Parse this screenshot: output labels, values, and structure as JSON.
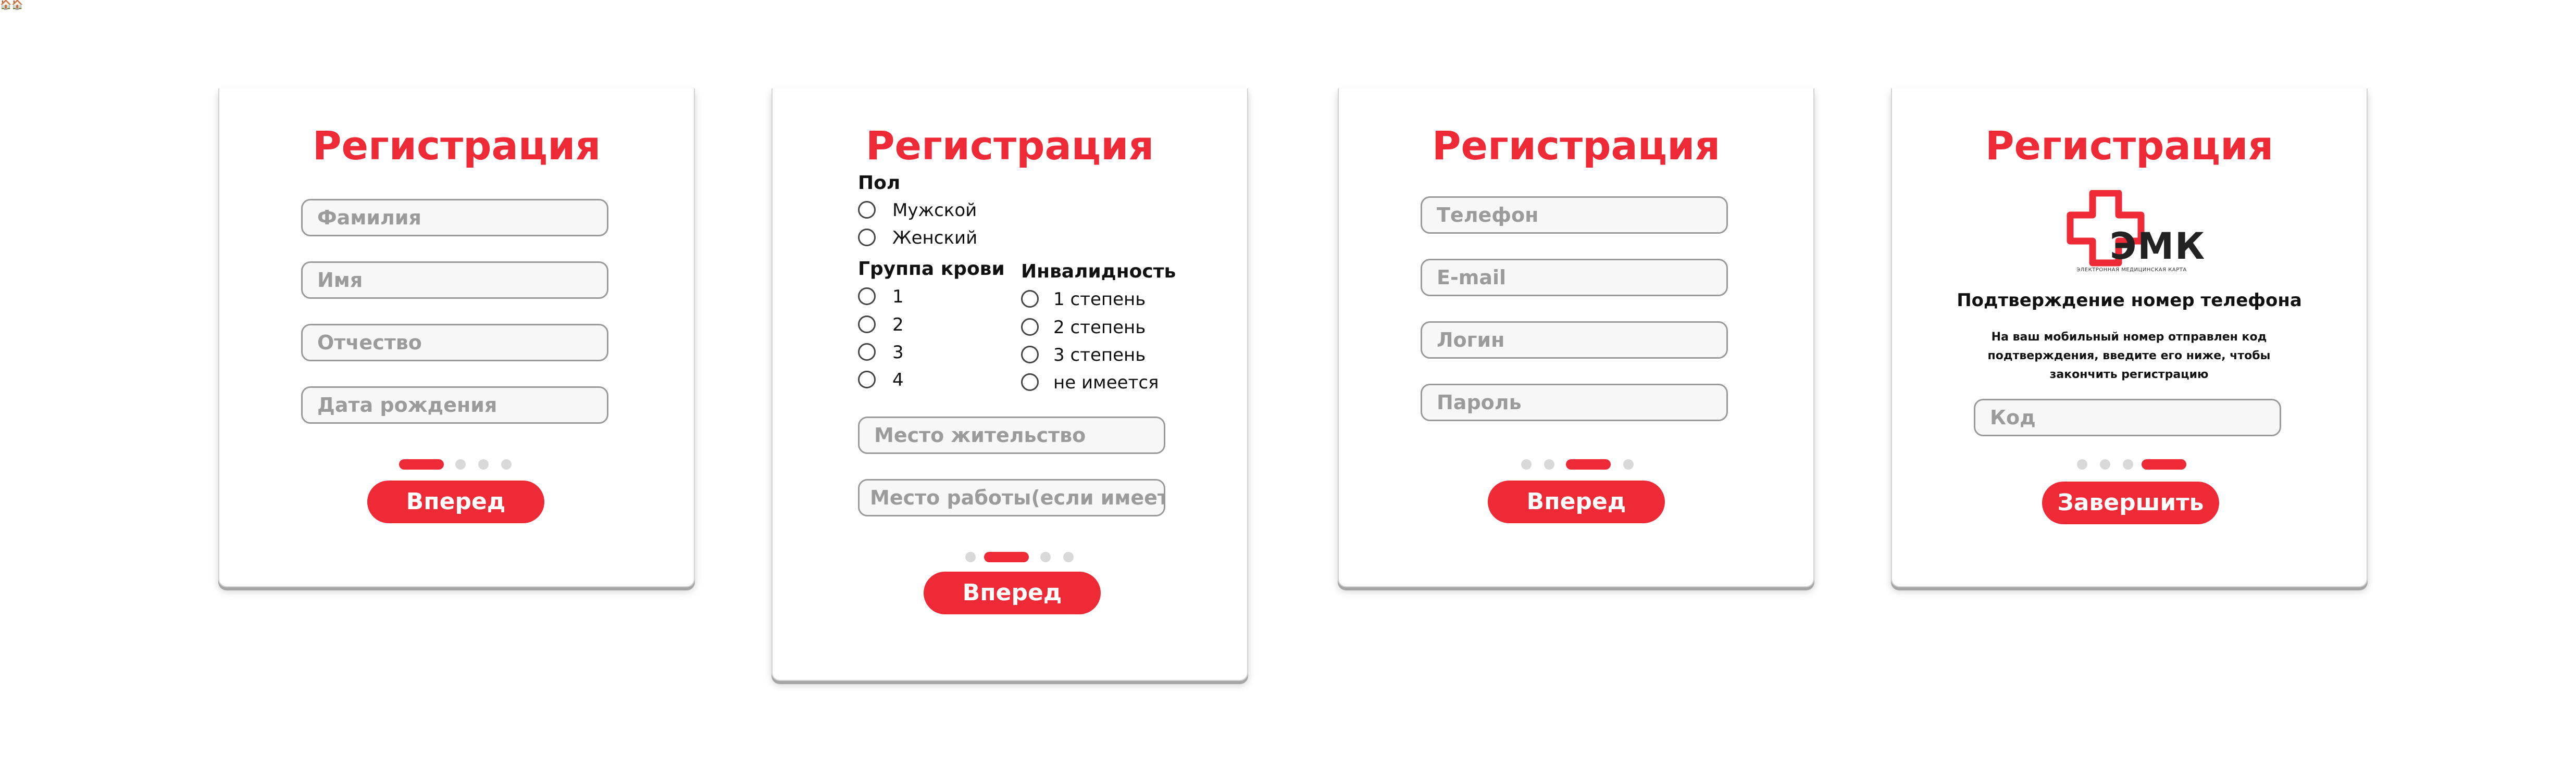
{
  "top_icons": "🏠🏠",
  "accent_color": "#ef2a37",
  "cards": [
    {
      "title": "Регистрация",
      "fields": [
        "Фамилия",
        "Имя",
        "Отчество",
        "Дата рождения"
      ],
      "active_step": 1,
      "button": "Вперед"
    },
    {
      "title": "Регистрация",
      "gender_label": "Пол",
      "gender_options": [
        "Мужской",
        "Женский"
      ],
      "blood_label": "Группа крови",
      "blood_options": [
        "1",
        "2",
        "3",
        "4"
      ],
      "disability_label": "Инвалидность",
      "disability_options": [
        "1 степень",
        "2 степень",
        "3 степень",
        "не имеется"
      ],
      "fields": [
        "Место жительство",
        "Место работы(если имеется)"
      ],
      "active_step": 2,
      "button": "Вперед"
    },
    {
      "title": "Регистрация",
      "fields": [
        "Телефон",
        "E-mail",
        "Логин",
        "Пароль"
      ],
      "active_step": 3,
      "button": "Вперед"
    },
    {
      "title": "Регистрация",
      "logo_text": "ЭМК",
      "logo_subtitle": "ЭЛЕКТРОННАЯ МЕДИЦИНСКАЯ КАРТА",
      "confirm_title": "Подтверждение номер телефона",
      "confirm_body": "На ваш мобильный номер отправлен код подтверждения, введите его ниже, чтобы закончить регистрацию",
      "fields": [
        "Код"
      ],
      "active_step": 4,
      "button": "Завершить"
    }
  ]
}
